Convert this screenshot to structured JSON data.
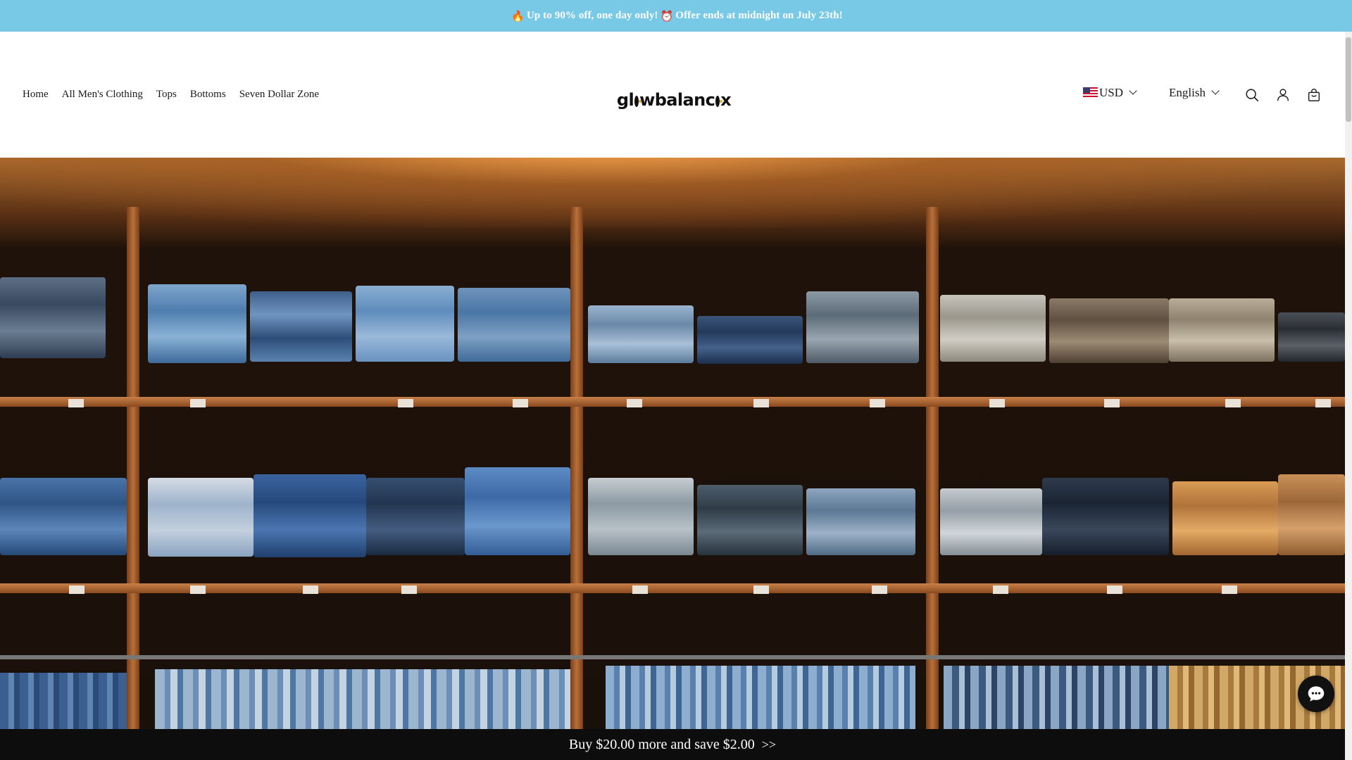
{
  "announcement": {
    "fire_emoji": "🔥",
    "text_1": "Up to 90% off, one day only!",
    "clock_emoji": "⏰",
    "text_2": "Offer ends at midnight on  July 23th!",
    "bg_color": "#78c9e6"
  },
  "nav": {
    "items": [
      {
        "label": "Home"
      },
      {
        "label": "All Men's Clothing"
      },
      {
        "label": "Tops"
      },
      {
        "label": "Bottoms"
      },
      {
        "label": "Seven Dollar Zone"
      }
    ]
  },
  "logo": {
    "part_1": "gl",
    "part_2": "wbalanc",
    "part_3": "x",
    "alt": "glowbalancex"
  },
  "tools": {
    "currency": "USD",
    "currency_icon": "us-flag-icon",
    "language": "English",
    "icons": [
      "search-icon",
      "account-icon",
      "cart-icon"
    ]
  },
  "hero": {
    "image_subject": "store shelves with folded denim and hanging shirts"
  },
  "bottom_bar": {
    "text": "Buy $20.00 more and save $2.00",
    "arrows": ">>"
  },
  "chat": {
    "icon": "chat-bubble-icon"
  }
}
